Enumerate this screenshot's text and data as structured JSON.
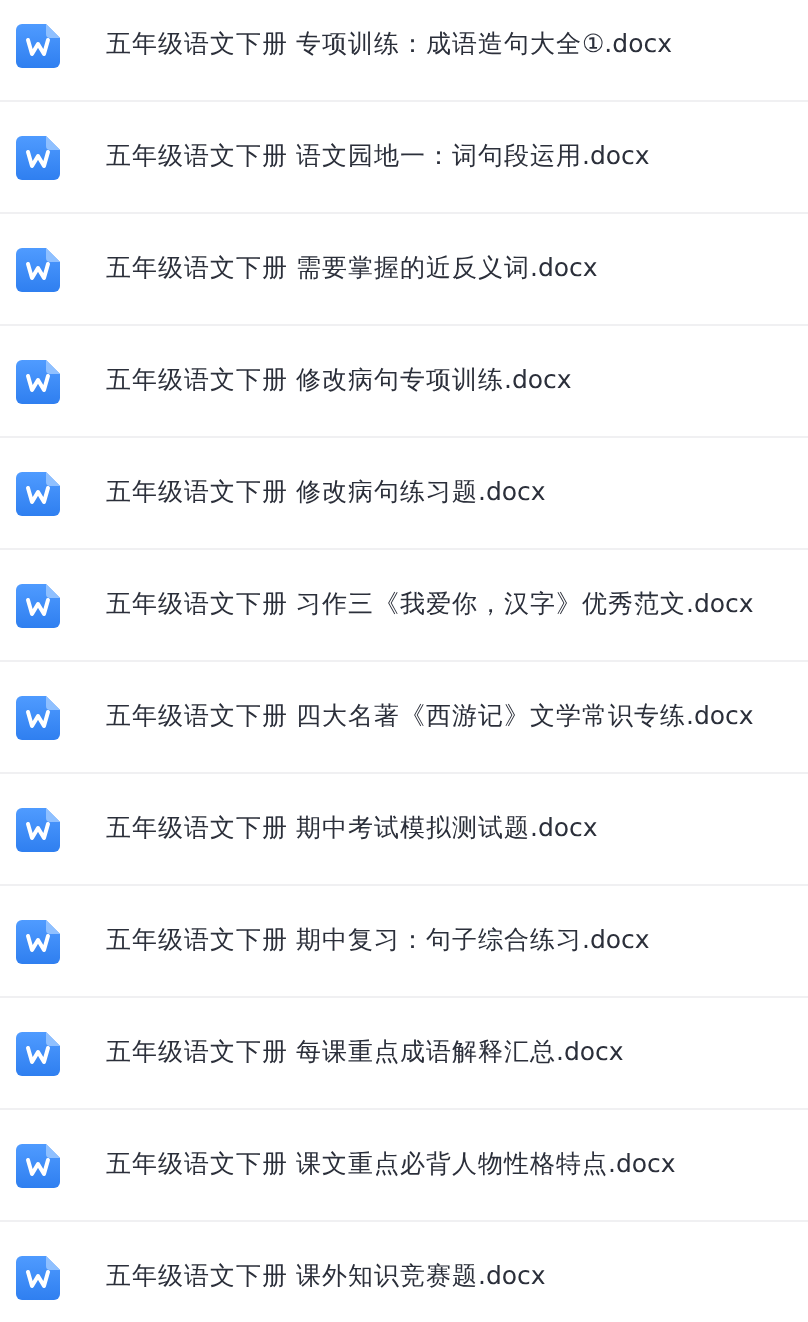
{
  "files": [
    {
      "name": "五年级语文下册 专项训练：成语造句大全①.docx"
    },
    {
      "name": "五年级语文下册 语文园地一：词句段运用.docx"
    },
    {
      "name": "五年级语文下册 需要掌握的近反义词.docx"
    },
    {
      "name": "五年级语文下册 修改病句专项训练.docx"
    },
    {
      "name": "五年级语文下册 修改病句练习题.docx"
    },
    {
      "name": "五年级语文下册 习作三《我爱你，汉字》优秀范文.docx"
    },
    {
      "name": "五年级语文下册 四大名著《西游记》文学常识专练.docx"
    },
    {
      "name": "五年级语文下册 期中考试模拟测试题.docx"
    },
    {
      "name": "五年级语文下册 期中复习：句子综合练习.docx"
    },
    {
      "name": "五年级语文下册 每课重点成语解释汇总.docx"
    },
    {
      "name": "五年级语文下册 课文重点必背人物性格特点.docx"
    },
    {
      "name": "五年级语文下册 课外知识竞赛题.docx"
    }
  ]
}
